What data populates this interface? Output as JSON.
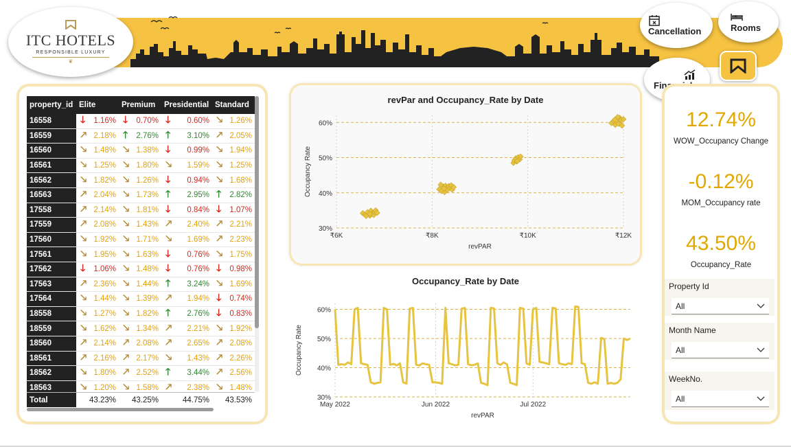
{
  "brand": {
    "title": "ITC HOTELS",
    "subtitle": "RESPONSIBLE LUXURY",
    "accent": "#f5c242"
  },
  "nav": {
    "cancellation": "Cancellation",
    "rooms": "Rooms",
    "financial": "Financial"
  },
  "table": {
    "headers": [
      "property_id",
      "Elite",
      "Premium",
      "Presidential",
      "Standard"
    ],
    "rows": [
      {
        "id": "16558",
        "cells": [
          [
            "down",
            "red",
            "1.16%"
          ],
          [
            "down",
            "red",
            "0.70%"
          ],
          [
            "down",
            "red",
            "0.60%"
          ],
          [
            "downright",
            "gold",
            "1.26%"
          ]
        ]
      },
      {
        "id": "16559",
        "cells": [
          [
            "upright",
            "gold",
            "2.18%"
          ],
          [
            "up",
            "green",
            "2.76%"
          ],
          [
            "up",
            "green",
            "3.10%"
          ],
          [
            "upright",
            "gold",
            "2.05%"
          ]
        ]
      },
      {
        "id": "16560",
        "cells": [
          [
            "downright",
            "gold",
            "1.48%"
          ],
          [
            "downright",
            "gold",
            "1.38%"
          ],
          [
            "down",
            "red",
            "0.99%"
          ],
          [
            "downright",
            "gold",
            "1.94%"
          ]
        ]
      },
      {
        "id": "16561",
        "cells": [
          [
            "downright",
            "gold",
            "1.25%"
          ],
          [
            "downright",
            "gold",
            "1.80%"
          ],
          [
            "downright",
            "gold",
            "1.59%"
          ],
          [
            "downright",
            "gold",
            "1.25%"
          ]
        ]
      },
      {
        "id": "16562",
        "cells": [
          [
            "downright",
            "gold",
            "1.82%"
          ],
          [
            "downright",
            "gold",
            "1.26%"
          ],
          [
            "down",
            "red",
            "0.94%"
          ],
          [
            "downright",
            "gold",
            "1.68%"
          ]
        ]
      },
      {
        "id": "16563",
        "cells": [
          [
            "upright",
            "gold",
            "2.04%"
          ],
          [
            "downright",
            "gold",
            "1.73%"
          ],
          [
            "up",
            "green",
            "2.95%"
          ],
          [
            "up",
            "green",
            "2.82%"
          ]
        ]
      },
      {
        "id": "17558",
        "cells": [
          [
            "upright",
            "gold",
            "2.14%"
          ],
          [
            "downright",
            "gold",
            "1.81%"
          ],
          [
            "down",
            "red",
            "0.84%"
          ],
          [
            "down",
            "red",
            "1.07%"
          ]
        ]
      },
      {
        "id": "17559",
        "cells": [
          [
            "upright",
            "gold",
            "2.08%"
          ],
          [
            "downright",
            "gold",
            "1.43%"
          ],
          [
            "upright",
            "gold",
            "2.40%"
          ],
          [
            "upright",
            "gold",
            "2.21%"
          ]
        ]
      },
      {
        "id": "17560",
        "cells": [
          [
            "downright",
            "gold",
            "1.92%"
          ],
          [
            "downright",
            "gold",
            "1.71%"
          ],
          [
            "downright",
            "gold",
            "1.69%"
          ],
          [
            "upright",
            "gold",
            "2.23%"
          ]
        ]
      },
      {
        "id": "17561",
        "cells": [
          [
            "downright",
            "gold",
            "1.95%"
          ],
          [
            "downright",
            "gold",
            "1.63%"
          ],
          [
            "down",
            "red",
            "0.76%"
          ],
          [
            "downright",
            "gold",
            "1.75%"
          ]
        ]
      },
      {
        "id": "17562",
        "cells": [
          [
            "down",
            "red",
            "1.06%"
          ],
          [
            "downright",
            "gold",
            "1.48%"
          ],
          [
            "down",
            "red",
            "0.76%"
          ],
          [
            "down",
            "red",
            "0.98%"
          ]
        ]
      },
      {
        "id": "17563",
        "cells": [
          [
            "upright",
            "gold",
            "2.36%"
          ],
          [
            "downright",
            "gold",
            "1.44%"
          ],
          [
            "up",
            "green",
            "3.24%"
          ],
          [
            "downright",
            "gold",
            "1.69%"
          ]
        ]
      },
      {
        "id": "17564",
        "cells": [
          [
            "downright",
            "gold",
            "1.44%"
          ],
          [
            "downright",
            "gold",
            "1.39%"
          ],
          [
            "upright",
            "gold",
            "1.94%"
          ],
          [
            "down",
            "red",
            "0.74%"
          ]
        ]
      },
      {
        "id": "18558",
        "cells": [
          [
            "downright",
            "gold",
            "1.27%"
          ],
          [
            "downright",
            "gold",
            "1.82%"
          ],
          [
            "up",
            "green",
            "2.76%"
          ],
          [
            "down",
            "red",
            "0.83%"
          ]
        ]
      },
      {
        "id": "18559",
        "cells": [
          [
            "downright",
            "gold",
            "1.62%"
          ],
          [
            "downright",
            "gold",
            "1.34%"
          ],
          [
            "upright",
            "gold",
            "2.21%"
          ],
          [
            "downright",
            "gold",
            "1.92%"
          ]
        ]
      },
      {
        "id": "18560",
        "cells": [
          [
            "upright",
            "gold",
            "2.14%"
          ],
          [
            "upright",
            "gold",
            "2.08%"
          ],
          [
            "upright",
            "gold",
            "2.65%"
          ],
          [
            "upright",
            "gold",
            "2.08%"
          ]
        ]
      },
      {
        "id": "18561",
        "cells": [
          [
            "upright",
            "gold",
            "2.16%"
          ],
          [
            "upright",
            "gold",
            "2.17%"
          ],
          [
            "downright",
            "gold",
            "1.43%"
          ],
          [
            "upright",
            "gold",
            "2.26%"
          ]
        ]
      },
      {
        "id": "18562",
        "cells": [
          [
            "downright",
            "gold",
            "1.80%"
          ],
          [
            "upright",
            "gold",
            "2.52%"
          ],
          [
            "up",
            "green",
            "3.44%"
          ],
          [
            "upright",
            "gold",
            "2.56%"
          ]
        ]
      },
      {
        "id": "18563",
        "cells": [
          [
            "downright",
            "gold",
            "1.20%"
          ],
          [
            "downright",
            "gold",
            "1.58%"
          ],
          [
            "upright",
            "gold",
            "2.38%"
          ],
          [
            "downright",
            "gold",
            "1.48%"
          ]
        ]
      }
    ],
    "total_label": "Total",
    "totals": [
      "43.23%",
      "43.25%",
      "44.75%",
      "43.53%"
    ]
  },
  "kpis": [
    {
      "value": "12.74%",
      "label": "WOW_Occupancy Change"
    },
    {
      "value": "-0.12%",
      "label": "MOM_Occupancy rate"
    },
    {
      "value": "43.50%",
      "label": "Occupancy_Rate"
    }
  ],
  "slicers": [
    {
      "title": "Property Id",
      "value": "All"
    },
    {
      "title": "Month Name",
      "value": "All"
    },
    {
      "title": "WeekNo.",
      "value": "All"
    }
  ],
  "colors": {
    "series": "#e6c440",
    "grid": "#d9b24a",
    "red": "#d9261c",
    "green": "#2e8b2e",
    "gold": "#e8a200"
  },
  "chart_data": [
    {
      "type": "scatter",
      "title": "revPar and Occupancy_Rate by Date",
      "xlabel": "revPAR",
      "ylabel": "Occupancy Rate",
      "xlim": [
        6000,
        12000
      ],
      "ylim": [
        30,
        62
      ],
      "xticks": [
        "₹6K",
        "₹8K",
        "₹10K",
        "₹12K"
      ],
      "xtick_values": [
        6000,
        8000,
        10000,
        12000
      ],
      "yticks": [
        "30%",
        "40%",
        "50%",
        "60%"
      ],
      "ytick_values": [
        30,
        40,
        50,
        60
      ],
      "grid": true,
      "points": [
        [
          6550,
          34.2
        ],
        [
          6600,
          33.8
        ],
        [
          6650,
          34.5
        ],
        [
          6700,
          33.5
        ],
        [
          6720,
          34.9
        ],
        [
          6750,
          34.1
        ],
        [
          6780,
          33.7
        ],
        [
          6800,
          34.6
        ],
        [
          6820,
          35.0
        ],
        [
          6850,
          34.3
        ],
        [
          6700,
          34.0
        ],
        [
          6620,
          33.4
        ],
        [
          8150,
          41.0
        ],
        [
          8200,
          40.5
        ],
        [
          8230,
          41.8
        ],
        [
          8260,
          40.2
        ],
        [
          8280,
          42.0
        ],
        [
          8300,
          41.3
        ],
        [
          8320,
          40.8
        ],
        [
          8350,
          41.9
        ],
        [
          8380,
          41.4
        ],
        [
          8400,
          42.1
        ],
        [
          8420,
          40.9
        ],
        [
          8450,
          41.6
        ],
        [
          8250,
          41.2
        ],
        [
          8180,
          42.3
        ],
        [
          9700,
          48.5
        ],
        [
          9720,
          49.2
        ],
        [
          9750,
          49.8
        ],
        [
          9770,
          48.9
        ],
        [
          9800,
          50.1
        ],
        [
          9830,
          49.5
        ],
        [
          9850,
          50.3
        ],
        [
          9780,
          49.0
        ],
        [
          11750,
          59.8
        ],
        [
          11800,
          60.4
        ],
        [
          11830,
          59.3
        ],
        [
          11850,
          61.0
        ],
        [
          11870,
          60.1
        ],
        [
          11900,
          59.6
        ],
        [
          11920,
          61.3
        ],
        [
          11950,
          60.7
        ],
        [
          11970,
          59.1
        ],
        [
          12000,
          60.9
        ],
        [
          11880,
          61.5
        ],
        [
          11820,
          60.8
        ]
      ]
    },
    {
      "type": "line",
      "title": "Occupancy_Rate by Date",
      "xlabel": "revPAR",
      "ylabel": "Occupancy Rate",
      "ylim": [
        30,
        62
      ],
      "yticks": [
        "30%",
        "40%",
        "50%",
        "60%"
      ],
      "ytick_values": [
        30,
        40,
        50,
        60
      ],
      "xticks": [
        "May 2022",
        "Jun 2022",
        "Jul 2022"
      ],
      "xtick_days": [
        0,
        31,
        61
      ],
      "series": [
        {
          "values": [
            60,
            41,
            41.2,
            41,
            41.8,
            41.2,
            60,
            60.5,
            41.5,
            41.2,
            41,
            35,
            34.5,
            34.8,
            35,
            60.5,
            60,
            41,
            41.3,
            40.8,
            41.5,
            35,
            34.5,
            60.2,
            60.5,
            41,
            40.8,
            41.5,
            41.2,
            41,
            35,
            35,
            34.8,
            34.5,
            60.5,
            41.5,
            41.2,
            40.8,
            41,
            60.2,
            60.5,
            41.2,
            40.8,
            41,
            41.5,
            34.8,
            34.5,
            34,
            60.5,
            60.3,
            41.5,
            41,
            41.8,
            41.2,
            34.8,
            34.5,
            34,
            60.5,
            60.2,
            41.5,
            41,
            60,
            60.5,
            42,
            41.8,
            41.5,
            41.2,
            60.5,
            60.3,
            41.5,
            41.2,
            41,
            41.5,
            41.2,
            61,
            60.8,
            41.5,
            41.2,
            34.8,
            34.5,
            35,
            34.5,
            50.2,
            49.8,
            34.5,
            34.8,
            34.5,
            34.8,
            36,
            50,
            49.5,
            50
          ]
        }
      ]
    }
  ]
}
